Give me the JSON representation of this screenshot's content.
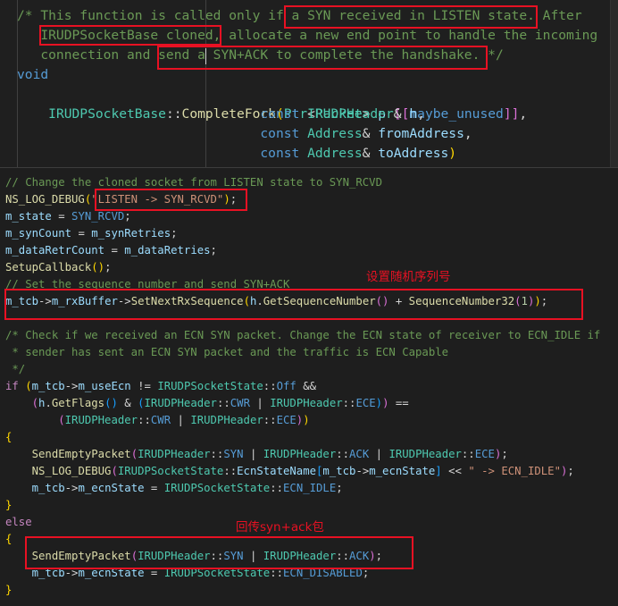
{
  "top_editor": {
    "lines": [
      "/* This function is called only if a SYN received in LISTEN state. After",
      "   IRUDPSocketBase cloned, allocate a new end point to handle the incoming",
      "   connection and send a SYN+ACK to complete the handshake. */",
      "void",
      "IRUDPSocketBase::CompleteFork(Ptr<Packet> p [[maybe_unused]],",
      "                               const IRUDPHeader& h,",
      "                               const Address& fromAddress,",
      "                               const Address& toAddress)"
    ]
  },
  "bottom_editor": {
    "lines": [
      "// Change the cloned socket from LISTEN state to SYN_RCVD",
      "NS_LOG_DEBUG(\"LISTEN -> SYN_RCVD\");",
      "m_state = SYN_RCVD;",
      "m_synCount = m_synRetries;",
      "m_dataRetrCount = m_dataRetries;",
      "SetupCallback();",
      "// Set the sequence number and send SYN+ACK",
      "m_tcb->m_rxBuffer->SetNextRxSequence(h.GetSequenceNumber() + SequenceNumber32(1));",
      "",
      "/* Check if we received an ECN SYN packet. Change the ECN state of receiver to ECN_IDLE if",
      " * sender has sent an ECN SYN packet and the traffic is ECN Capable",
      " */",
      "if (m_tcb->m_useEcn != IRUDPSocketState::Off &&",
      "    (h.GetFlags() & (IRUDPHeader::CWR | IRUDPHeader::ECE)) ==",
      "        (IRUDPHeader::CWR | IRUDPHeader::ECE))",
      "{",
      "    SendEmptyPacket(IRUDPHeader::SYN | IRUDPHeader::ACK | IRUDPHeader::ECE);",
      "    NS_LOG_DEBUG(IRUDPSocketState::EcnStateName[m_tcb->m_ecnState] << \" -> ECN_IDLE\");",
      "    m_tcb->m_ecnState = IRUDPSocketState::ECN_IDLE;",
      "}",
      "else",
      "{",
      "    SendEmptyPacket(IRUDPHeader::SYN | IRUDPHeader::ACK);",
      "    m_tcb->m_ecnState = IRUDPSocketState::ECN_DISABLED;",
      "}"
    ]
  },
  "annotations": {
    "set_random_seq": "设置随机序列号",
    "return_syn_ack": "回传syn+ack包"
  },
  "colors": {
    "annotation": "#e81123",
    "background": "#1e1e1e",
    "comment": "#6a9955",
    "keyword": "#569cd6",
    "type": "#4ec9b0",
    "function": "#dcdcaa",
    "variable": "#9cdcfe",
    "string": "#ce9178"
  }
}
